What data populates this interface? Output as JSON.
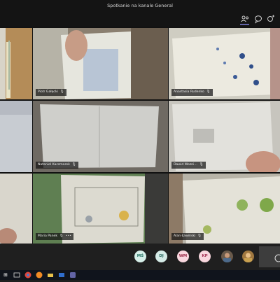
{
  "window": {
    "title": "Spotkanie na kanale General"
  },
  "toolbar": {
    "icons": [
      "participants-icon",
      "chat-icon",
      "reactions-icon"
    ]
  },
  "participants": [
    {
      "name": "Piotr Gałęcki",
      "mic": "mic-icon"
    },
    {
      "name": "Anastasia Rudenko",
      "mic": "mic-icon"
    },
    {
      "name": "Nataniel Kaczmarek",
      "mic": "mic-icon"
    },
    {
      "name": "Dawid Wozni...",
      "mic": "mic-icon"
    },
    {
      "name": "Maria Panek",
      "mic": "mic-icon",
      "more": "•••"
    },
    {
      "name": "Alan Ławiński",
      "mic": "mic-icon"
    }
  ],
  "roster": {
    "avatars": [
      {
        "initials": "MŚ",
        "bg": "#d6efe9",
        "fg": "#1f6f60"
      },
      {
        "initials": "DJ",
        "bg": "#d5ebe7",
        "fg": "#2c6b62"
      },
      {
        "initials": "WM",
        "bg": "#f8d7de",
        "fg": "#9b2c49"
      },
      {
        "initials": "KP",
        "bg": "#f8d7de",
        "fg": "#a33355"
      }
    ]
  },
  "colors": {
    "accent": "#6264a7",
    "background": "#1f1f1f",
    "titlebar": "#141414"
  }
}
